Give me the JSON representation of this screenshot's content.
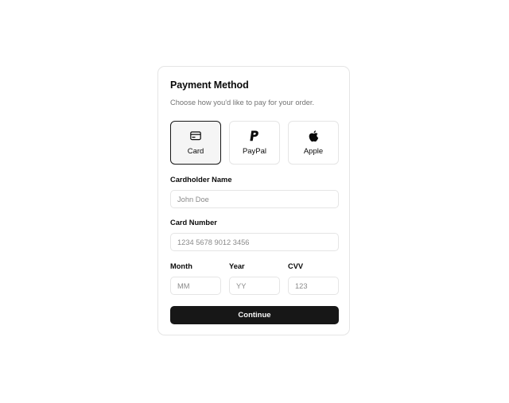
{
  "header": {
    "title": "Payment Method",
    "subtitle": "Choose how you'd like to pay for your order."
  },
  "methods": [
    {
      "label": "Card",
      "icon": "credit-card-icon",
      "selected": true
    },
    {
      "label": "PayPal",
      "icon": "paypal-icon",
      "selected": false
    },
    {
      "label": "Apple",
      "icon": "apple-icon",
      "selected": false
    }
  ],
  "form": {
    "cardholder": {
      "label": "Cardholder Name",
      "value": "",
      "placeholder": "John Doe"
    },
    "card_number": {
      "label": "Card Number",
      "value": "",
      "placeholder": "1234 5678 9012 3456"
    },
    "month": {
      "label": "Month",
      "value": "",
      "placeholder": "MM"
    },
    "year": {
      "label": "Year",
      "value": "",
      "placeholder": "YY"
    },
    "cvv": {
      "label": "CVV",
      "value": "",
      "placeholder": "123"
    }
  },
  "actions": {
    "continue_label": "Continue"
  },
  "colors": {
    "primary": "#171717",
    "border": "#e5e5e5",
    "muted_text": "#737373",
    "selected_bg": "#f5f5f5"
  }
}
